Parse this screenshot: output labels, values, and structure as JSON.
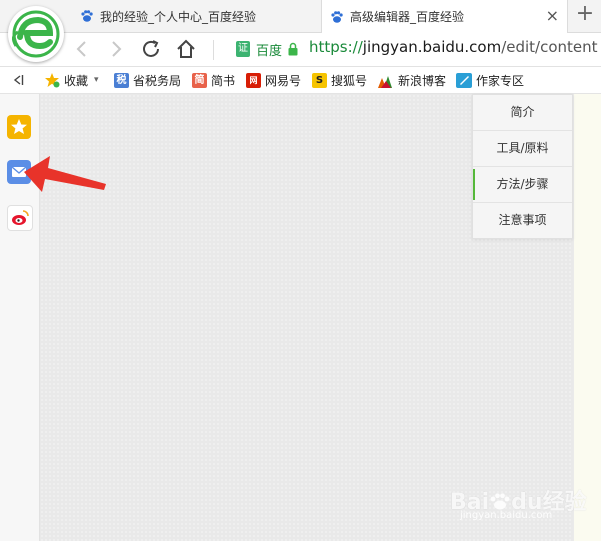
{
  "tabs": [
    {
      "title": "我的经验_个人中心_百度经验",
      "active": false
    },
    {
      "title": "高级编辑器_百度经验",
      "active": true
    }
  ],
  "tab_close": "×",
  "new_tab": "+",
  "address_bar": {
    "cert_badge": "证",
    "cert_name": "百度",
    "url_scheme": "https://",
    "url_host": "jingyan.baidu.com",
    "url_path": "/edit/content"
  },
  "bookmarks": {
    "toggle": "ᐸ|",
    "items": [
      {
        "label": "收藏",
        "icon": "star-icon",
        "color": "#f5b400"
      },
      {
        "label": "省税务局",
        "icon": "tax-bureau-icon",
        "color": "#4a7fd4",
        "glyph": "税"
      },
      {
        "label": "简书",
        "icon": "jianshu-icon",
        "color": "#e8624a",
        "glyph": "简"
      },
      {
        "label": "网易号",
        "icon": "netease-icon",
        "color": "#d81e06",
        "glyph": "网"
      },
      {
        "label": "搜狐号",
        "icon": "sohu-icon",
        "color": "#f6c400",
        "glyph": "S"
      },
      {
        "label": "新浪博客",
        "icon": "sina-blog-icon",
        "color": "#e35b00"
      },
      {
        "label": "作家专区",
        "icon": "writer-zone-icon",
        "color": "#2a9fd6"
      }
    ]
  },
  "sidebar": {
    "items": [
      {
        "icon": "favorites-star-icon",
        "color": "#f5b400"
      },
      {
        "icon": "mail-icon",
        "color": "#5b8ee6"
      },
      {
        "icon": "weibo-icon",
        "color": "#e6162d"
      }
    ]
  },
  "nav_menu": {
    "items": [
      {
        "label": "简介",
        "active": false
      },
      {
        "label": "工具/原料",
        "active": false
      },
      {
        "label": "方法/步骤",
        "active": true
      },
      {
        "label": "注意事项",
        "active": false
      }
    ]
  },
  "watermark": {
    "text_brand": "Bai",
    "text_brand2": "du",
    "text_suffix": "经验",
    "domain": "jingyan.baidu.com"
  },
  "colors": {
    "accent_green": "#55b83a",
    "url_green": "#1a8a3a",
    "arrow_red": "#e8332a"
  }
}
